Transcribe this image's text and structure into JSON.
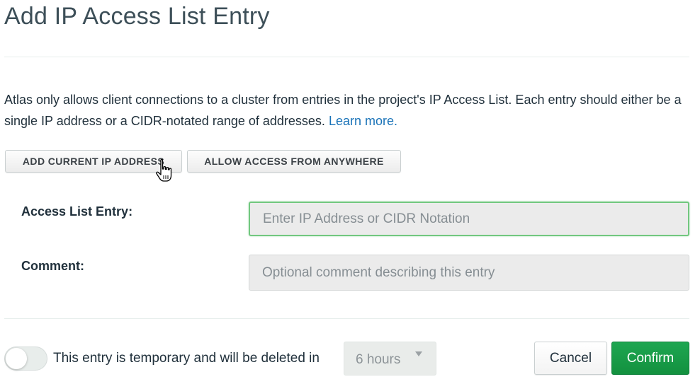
{
  "modal": {
    "title": "Add IP Access List Entry",
    "description": "Atlas only allows client connections to a cluster from entries in the project's IP Access List. Each entry should either be a single IP address or a CIDR-notated range of addresses.",
    "learn_more_label": "Learn more."
  },
  "actions": {
    "add_current_ip_label": "ADD CURRENT IP ADDRESS",
    "allow_anywhere_label": "ALLOW ACCESS FROM ANYWHERE"
  },
  "form": {
    "entry_label": "Access List Entry:",
    "entry_value": "",
    "entry_placeholder": "Enter IP Address or CIDR Notation",
    "comment_label": "Comment:",
    "comment_value": "",
    "comment_placeholder": "Optional comment describing this entry"
  },
  "footer": {
    "temporary_toggle_on": false,
    "temporary_text": "This entry is temporary and will be deleted in",
    "duration_selected": "6 hours",
    "cancel_label": "Cancel",
    "confirm_label": "Confirm"
  },
  "icons": {
    "cursor": "hand-pointer-cursor-icon",
    "dropdown": "caret-down-icon"
  },
  "colors": {
    "link": "#1a73b8",
    "confirm_button": "#13913f",
    "input_focus_border": "#72c77f",
    "input_background": "#ebebeb"
  }
}
